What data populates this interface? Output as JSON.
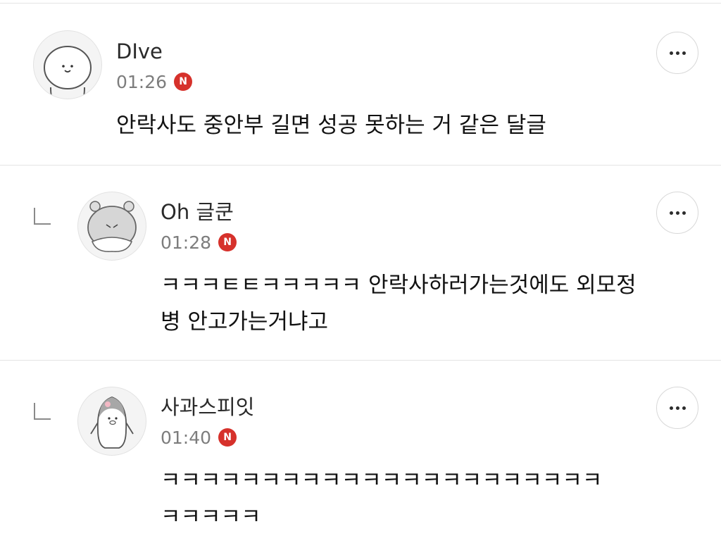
{
  "comments": [
    {
      "author": "DIve",
      "time": "01:26",
      "badge": "N",
      "text": "안락사도 중안부 길면 성공 못하는 거 같은 달글",
      "is_reply": false
    },
    {
      "author": "Oh 글쿤",
      "time": "01:28",
      "badge": "N",
      "text_lines": [
        "ㅋㅋㅋㅌㅌㅋㅋㅋㅋㅋ 안락사하러가는것에도 외모정",
        "병 안고가는거냐고"
      ],
      "is_reply": true
    },
    {
      "author": "사과스피잇",
      "time": "01:40",
      "badge": "N",
      "text_lines": [
        "ㅋㅋㅋㅋㅋㅋㅋㅋㅋㅋㅋㅋㅋㅋㅋㅋㅋㅋㅋㅋㅋㅋ",
        "ㅋㅋㅋㅋㅋ"
      ],
      "is_reply": true
    }
  ],
  "icons": {
    "more": "more-options-icon",
    "reply": "reply-arrow-icon",
    "new_badge": "new-badge"
  },
  "colors": {
    "badge": "#d6312b",
    "divider": "#e4e4e4",
    "time": "#7d7d7d"
  }
}
